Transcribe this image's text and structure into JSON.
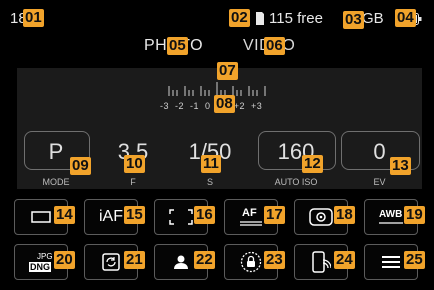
{
  "status_bar": {
    "time": "18h",
    "card_icon": "sd-card-icon",
    "shots_free": "115 free",
    "storage": "GB",
    "battery_icon": "battery-icon"
  },
  "modes": {
    "photo": "PHOTO",
    "video": "VIDEO"
  },
  "exposure_scale": {
    "labels": "-3  -2  -1  0  +1  +2  +3"
  },
  "params": [
    {
      "value": "P",
      "label": "MODE"
    },
    {
      "value": "3.5",
      "label": "F"
    },
    {
      "value": "1/50",
      "label": "S"
    },
    {
      "value": "160",
      "label": "AUTO ISO"
    },
    {
      "value": "0",
      "label": "EV"
    }
  ],
  "tiles": {
    "row1": [
      "drive-mode-icon",
      "focus-mode-iaf-icon",
      "af-field-icon",
      "af-settings-icon",
      "metering-icon",
      "white-balance-awb-icon"
    ],
    "row2": [
      "file-format-jpg-dng-icon",
      "stabilization-icon",
      "user-profile-icon",
      "lock-icon",
      "smartphone-connect-icon",
      "menu-icon"
    ],
    "iaf_text": "iAF",
    "af_text": "AF",
    "awb_text": "AWB",
    "jpg_text": "JPG",
    "dng_text": "DNG"
  },
  "callouts": [
    "01",
    "02",
    "03",
    "04",
    "05",
    "06",
    "07",
    "08",
    "09",
    "10",
    "11",
    "12",
    "13",
    "14",
    "15",
    "16",
    "17",
    "18",
    "19",
    "20",
    "21",
    "22",
    "23",
    "24",
    "25"
  ]
}
